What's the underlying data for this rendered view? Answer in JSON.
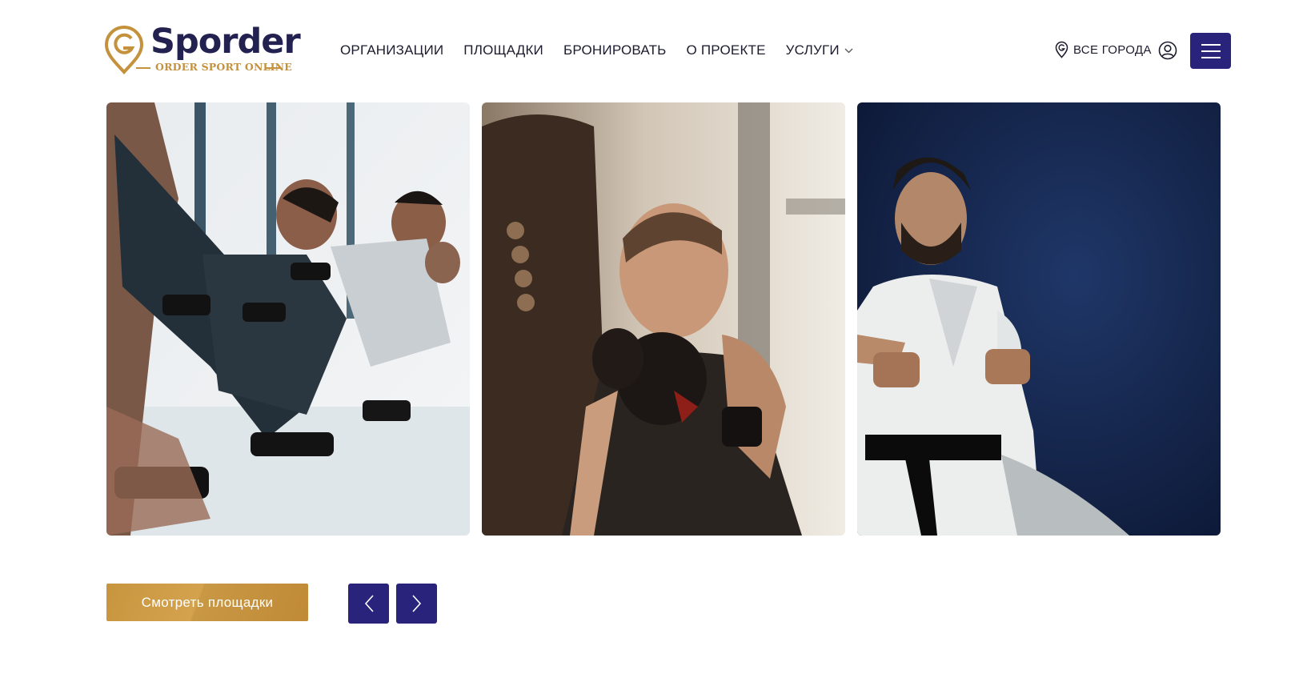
{
  "brand": {
    "name": "Sporder",
    "tagline": "ORDER SPORT ONLINE"
  },
  "nav": {
    "items": [
      {
        "label": "ОРГАНИЗАЦИИ"
      },
      {
        "label": "ПЛОЩАДКИ"
      },
      {
        "label": "БРОНИРОВАТЬ"
      },
      {
        "label": "О ПРОЕКТЕ"
      },
      {
        "label": "УСЛУГИ",
        "dropdown": true
      }
    ]
  },
  "header": {
    "city_label": "ВСЕ ГОРОДА",
    "icons": [
      "location-pin-icon",
      "user-icon",
      "menu-icon"
    ]
  },
  "gallery": {
    "images": [
      {
        "subject": "dumbbell-row-workout-photo"
      },
      {
        "subject": "boxer-punching-bag-photo"
      },
      {
        "subject": "karate-fighter-photo"
      }
    ]
  },
  "actions": {
    "cta_label": "Смотреть площадки",
    "prev_icon": "chevron-left-icon",
    "next_icon": "chevron-right-icon"
  },
  "colors": {
    "brand_navy": "#23214f",
    "button_navy": "#29237c",
    "gold": "#c4913c"
  }
}
